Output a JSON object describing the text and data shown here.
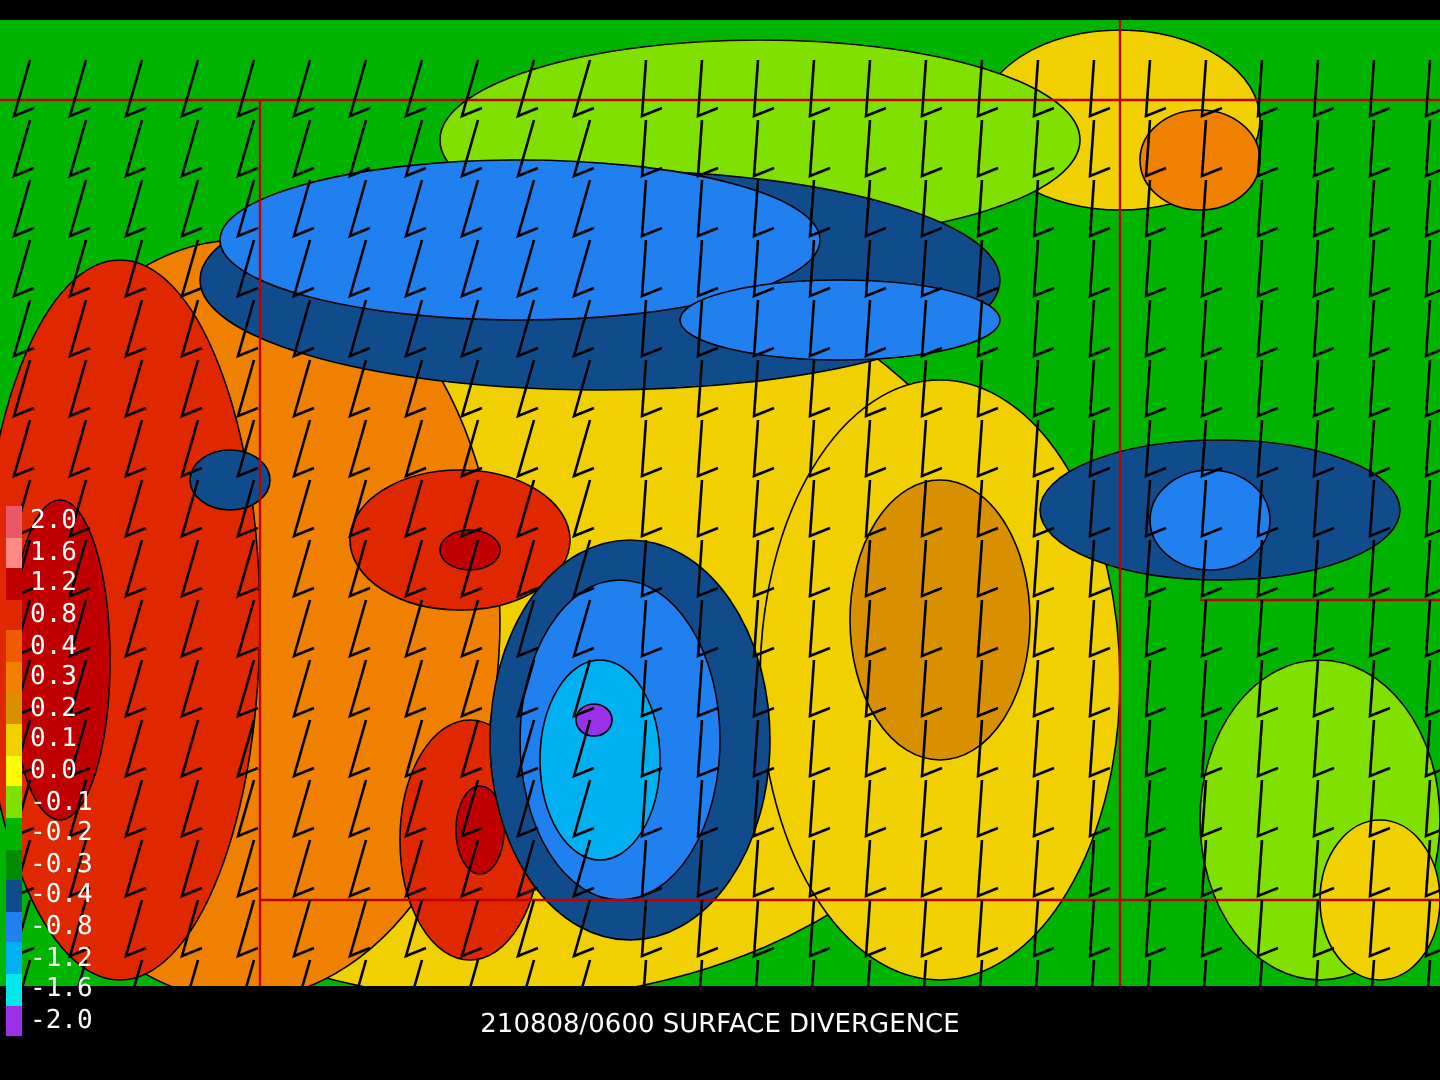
{
  "legend": [
    {
      "label": "2.0",
      "color": "#e85868"
    },
    {
      "label": "1.6",
      "color": "#ff8888"
    },
    {
      "label": "1.2",
      "color": "#c00000"
    },
    {
      "label": "0.8",
      "color": "#e02800"
    },
    {
      "label": "0.4",
      "color": "#f05a00"
    },
    {
      "label": "0.3",
      "color": "#f08000"
    },
    {
      "label": "0.2",
      "color": "#d89000"
    },
    {
      "label": "0.1",
      "color": "#f0d000"
    },
    {
      "label": "0.0",
      "color": "#ffff00"
    },
    {
      "label": "-0.1",
      "color": "#80e000"
    },
    {
      "label": "-0.2",
      "color": "#00b400"
    },
    {
      "label": "-0.3",
      "color": "#008c00"
    },
    {
      "label": "-0.4",
      "color": "#104c8c"
    },
    {
      "label": "-0.8",
      "color": "#2080f0"
    },
    {
      "label": "-1.2",
      "color": "#00b0f0"
    },
    {
      "label": "-1.6",
      "color": "#00e8e8"
    },
    {
      "label": "-2.0",
      "color": "#9a30e8"
    }
  ],
  "caption": "210808/0600 SURFACE DIVERGENCE"
}
